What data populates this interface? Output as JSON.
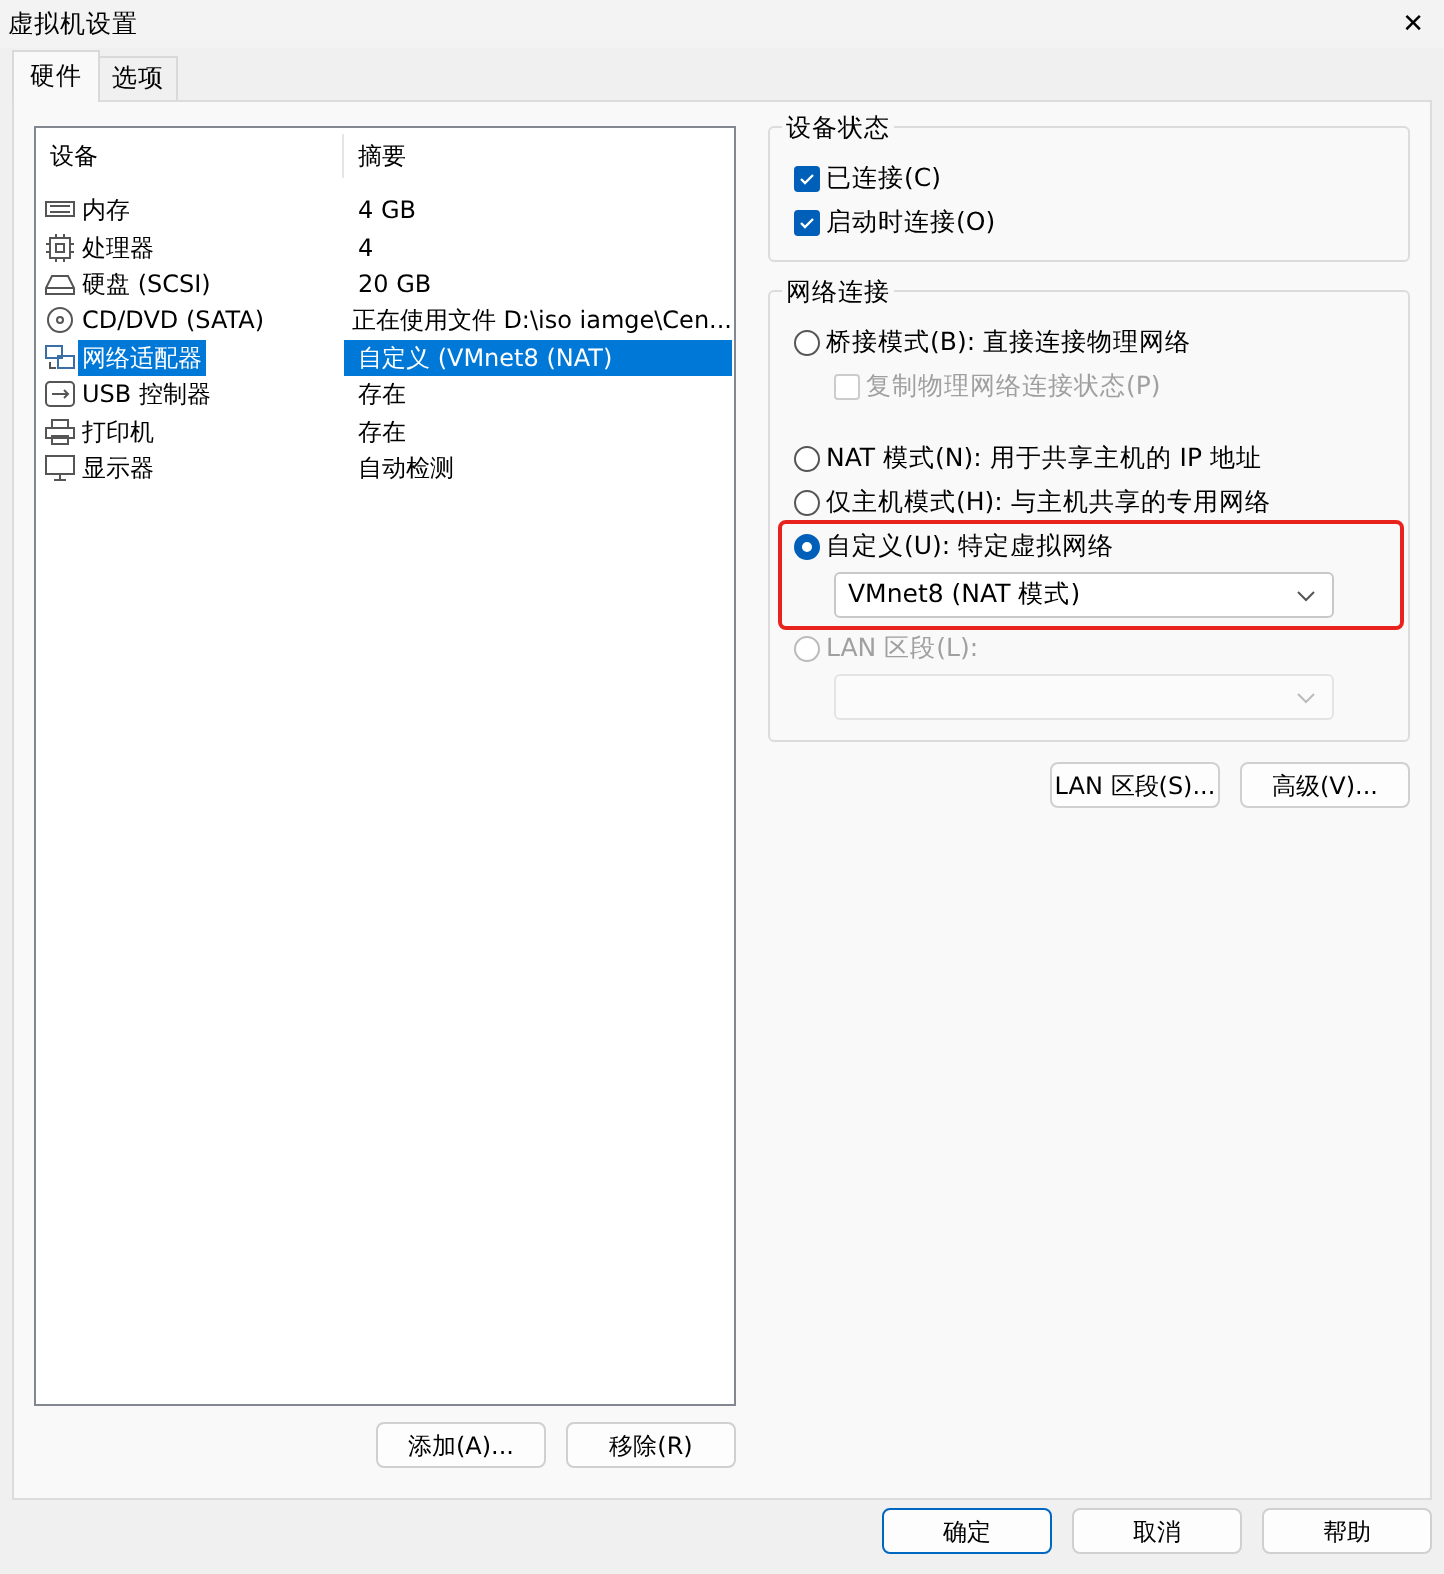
{
  "window": {
    "title": "虚拟机设置",
    "close": "✕"
  },
  "tabs": [
    {
      "label": "硬件",
      "selected": true
    },
    {
      "label": "选项",
      "selected": false
    }
  ],
  "devices": {
    "columns": [
      "设备",
      "摘要"
    ],
    "rows": [
      {
        "name": "内存",
        "summary": "4 GB",
        "selected": false
      },
      {
        "name": "处理器",
        "summary": "4",
        "selected": false
      },
      {
        "name": "硬盘 (SCSI)",
        "summary": "20 GB",
        "selected": false
      },
      {
        "name": "CD/DVD (SATA)",
        "summary": "正在使用文件 D:\\iso iamge\\Cen...",
        "selected": false
      },
      {
        "name": "网络适配器",
        "summary": "自定义 (VMnet8 (NAT)",
        "selected": true
      },
      {
        "name": "USB 控制器",
        "summary": "存在",
        "selected": false
      },
      {
        "name": "打印机",
        "summary": "存在",
        "selected": false
      },
      {
        "name": "显示器",
        "summary": "自动检测",
        "selected": false
      }
    ],
    "buttons": [
      "添加(A)...",
      "移除(R)"
    ]
  },
  "device_status": {
    "title": "设备状态",
    "items": [
      {
        "label": "已连接(C)",
        "checked": true
      },
      {
        "label": "启动时连接(O)",
        "checked": true
      }
    ]
  },
  "network_connection": {
    "title": "网络连接",
    "options": [
      {
        "kind": "radio",
        "label": "桥接模式(B): 直接连接物理网络",
        "selected": false,
        "disabled": false,
        "highlighted": false
      },
      {
        "kind": "checkbox",
        "label": "复制物理网络连接状态(P)",
        "checked": false,
        "disabled": true
      },
      {
        "kind": "radio",
        "label": "NAT 模式(N): 用于共享主机的 IP 地址",
        "selected": false,
        "disabled": false,
        "highlighted": false
      },
      {
        "kind": "radio",
        "label": "仅主机模式(H): 与主机共享的专用网络",
        "selected": false,
        "disabled": false,
        "highlighted": false
      },
      {
        "kind": "radio",
        "label": "自定义(U): 特定虚拟网络",
        "selected": true,
        "disabled": false,
        "highlighted": true,
        "dropdown": {
          "value": "VMnet8 (NAT 模式)",
          "disabled": false
        }
      },
      {
        "kind": "radio",
        "label": "LAN 区段(L):",
        "selected": false,
        "disabled": true,
        "highlighted": false
      },
      {
        "kind": "dropdown",
        "disabled": true
      }
    ],
    "buttons": [
      "LAN 区段(S)...",
      "高级(V)..."
    ]
  },
  "footer_buttons": [
    {
      "label": "确定",
      "default": true
    },
    {
      "label": "取消",
      "default": false
    },
    {
      "label": "帮助",
      "default": false
    }
  ]
}
